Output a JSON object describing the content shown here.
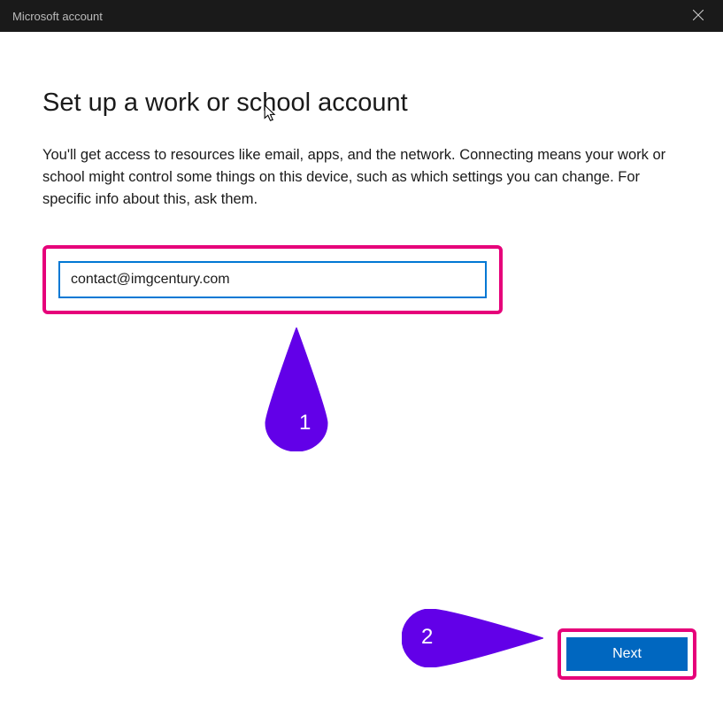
{
  "titlebar": {
    "title": "Microsoft account"
  },
  "main": {
    "heading": "Set up a work or school account",
    "description": "You'll get access to resources like email, apps, and the network. Connecting means your work or school might control some things on this device, such as which settings you can change. For specific info about this, ask them.",
    "email_value": "contact@imgcentury.com",
    "next_label": "Next"
  },
  "annotations": {
    "marker_1": "1",
    "marker_2": "2"
  },
  "colors": {
    "accent_blue": "#0067c0",
    "input_border": "#0078d4",
    "callout_pink": "#e6007a",
    "annotation_purple": "#6200e8"
  }
}
